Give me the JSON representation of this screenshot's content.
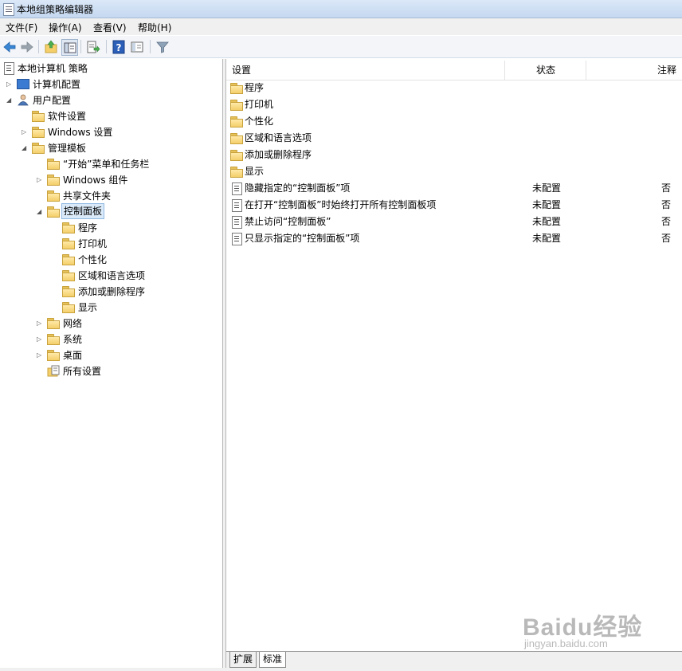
{
  "window": {
    "title": "本地组策略编辑器"
  },
  "menu": [
    "文件(F)",
    "操作(A)",
    "查看(V)",
    "帮助(H)"
  ],
  "toolbar": {
    "buttons": [
      "back-icon",
      "forward-icon",
      "up-folder-icon",
      "show-hide-tree-icon",
      "export-list-icon",
      "help-icon",
      "properties-view-icon",
      "filter-icon"
    ]
  },
  "tree": {
    "root": "本地计算机 策略",
    "computer": "计算机配置",
    "user": "用户配置",
    "software": "软件设置",
    "windows_settings": "Windows 设置",
    "admin_templates": "管理模板",
    "start_menu": "“开始”菜单和任务栏",
    "windows_components": "Windows 组件",
    "shared_folders": "共享文件夹",
    "control_panel": "控制面板",
    "cp_children": [
      "程序",
      "打印机",
      "个性化",
      "区域和语言选项",
      "添加或删除程序",
      "显示"
    ],
    "network": "网络",
    "system": "系统",
    "desktop": "桌面",
    "all_settings": "所有设置"
  },
  "list": {
    "headers": {
      "setting": "设置",
      "state": "状态",
      "comment": "注释"
    },
    "folders": [
      "程序",
      "打印机",
      "个性化",
      "区域和语言选项",
      "添加或删除程序",
      "显示"
    ],
    "policies": [
      {
        "name": "隐藏指定的“控制面板”项",
        "state": "未配置",
        "comment": "否"
      },
      {
        "name": "在打开“控制面板”时始终打开所有控制面板项",
        "state": "未配置",
        "comment": "否"
      },
      {
        "name": "禁止访问“控制面板”",
        "state": "未配置",
        "comment": "否"
      },
      {
        "name": "只显示指定的“控制面板”项",
        "state": "未配置",
        "comment": "否"
      }
    ]
  },
  "tabs": {
    "extended": "扩展",
    "standard": "标准"
  },
  "watermark": {
    "main": "Baidu经验",
    "sub": "jingyan.baidu.com"
  }
}
